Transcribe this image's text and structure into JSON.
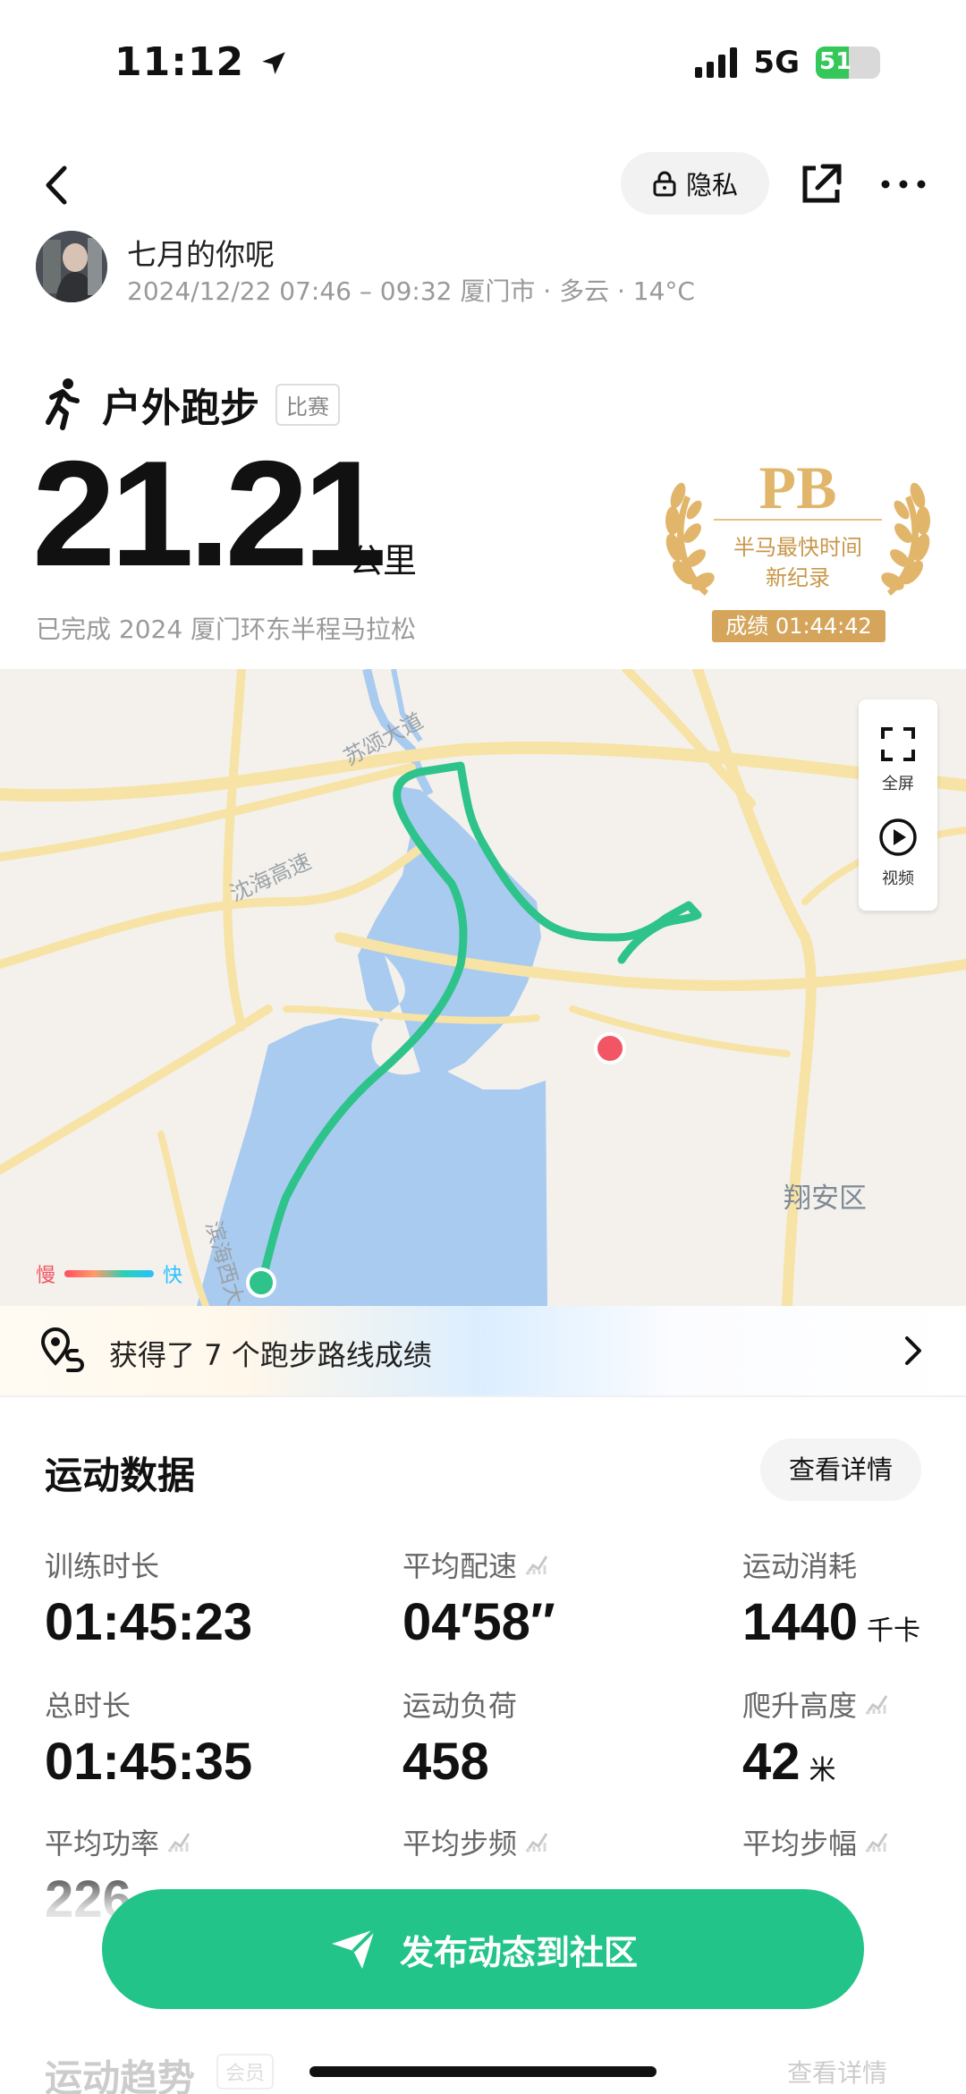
{
  "status_bar": {
    "time": "11:12",
    "network": "5G",
    "battery": "51",
    "battery_level": 0.51
  },
  "header": {
    "privacy_label": "隐私"
  },
  "user": {
    "name": "七月的你呢",
    "meta": "2024/12/22 07:46 – 09:32 厦门市 · 多云 · 14°C"
  },
  "workout": {
    "type": "户外跑步",
    "tag": "比赛",
    "distance": "21.21",
    "distance_unit": "公里",
    "race_description": "已完成 2024 厦门环东半程马拉松"
  },
  "pb_badge": {
    "title": "PB",
    "line1": "半马最快时间",
    "line2": "新纪录",
    "result": "成绩 01:44:42"
  },
  "map": {
    "labels": [
      "苏颂大道",
      "沈海高速",
      "翔安区",
      "滨海西大"
    ],
    "tools": [
      {
        "label": "全屏",
        "icon": "fullscreen-icon"
      },
      {
        "label": "视频",
        "icon": "play-icon"
      }
    ],
    "legend_slow": "慢",
    "legend_fast": "快",
    "route_color": "#2ec38a",
    "end_marker_color": "#f25563"
  },
  "achievement": {
    "text": "获得了 7 个跑步路线成绩"
  },
  "stats": {
    "title": "运动数据",
    "detail_label": "查看详情",
    "items": [
      {
        "label": "训练时长",
        "value": "01:45:23",
        "unit": ""
      },
      {
        "label": "平均配速",
        "value": "04′58″",
        "unit": ""
      },
      {
        "label": "运动消耗",
        "value": "1440",
        "unit": "千卡"
      },
      {
        "label": "总时长",
        "value": "01:45:35",
        "unit": ""
      },
      {
        "label": "运动负荷",
        "value": "458",
        "unit": ""
      },
      {
        "label": "爬升高度",
        "value": "42",
        "unit": "米"
      },
      {
        "label": "平均功率",
        "value": "226",
        "unit": ""
      },
      {
        "label": "平均步频",
        "value": "",
        "unit": ""
      },
      {
        "label": "平均步幅",
        "value": "",
        "unit": ""
      }
    ]
  },
  "publish": {
    "label": "发布动态到社区"
  },
  "trend": {
    "title": "运动趋势",
    "tag": "会员",
    "detail_label": "查看详情"
  }
}
